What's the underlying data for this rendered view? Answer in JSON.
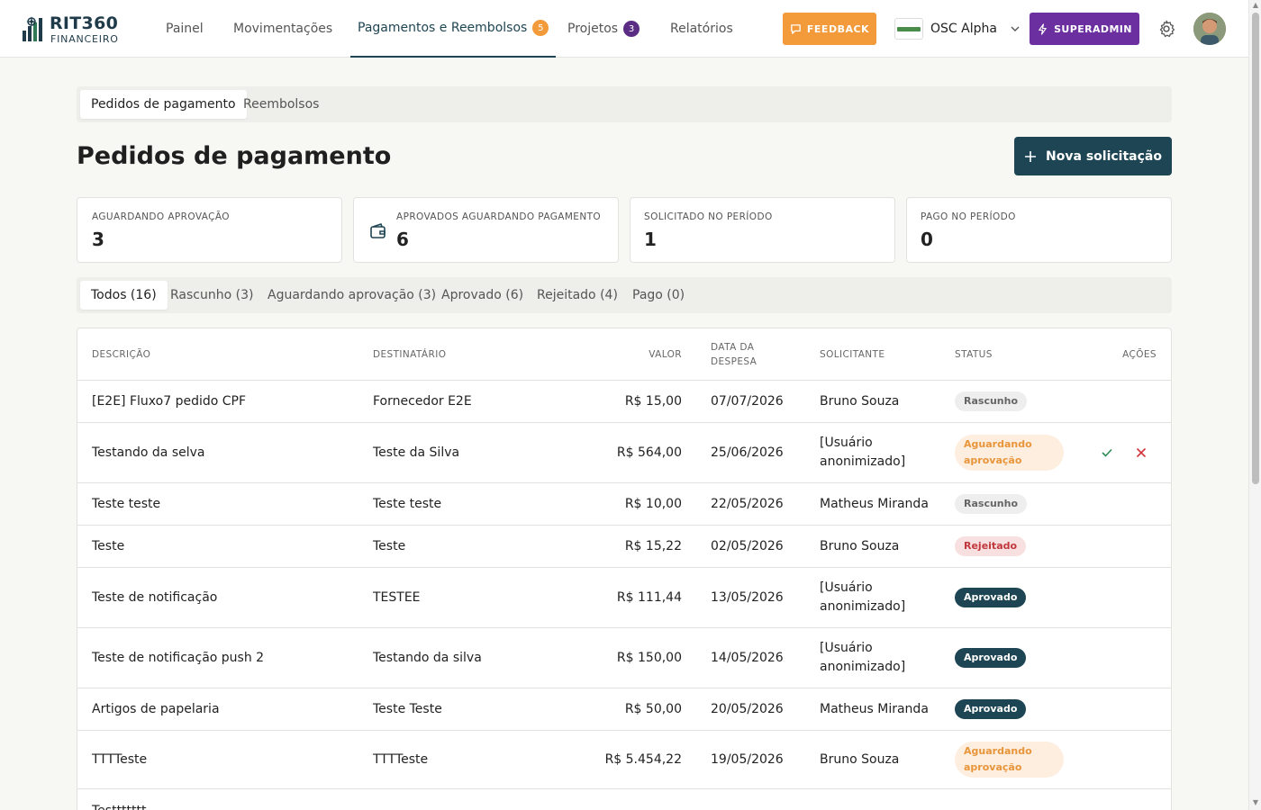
{
  "app": {
    "logo_title": "RIT360",
    "logo_sub": "FINANCEIRO"
  },
  "nav": {
    "items": [
      {
        "label": "Painel"
      },
      {
        "label": "Movimentações"
      },
      {
        "label": "Pagamentos e Reembolsos",
        "badge": "5",
        "badge_color": "#f39a3a"
      },
      {
        "label": "Projetos",
        "badge": "3",
        "badge_color": "#5b2c83"
      },
      {
        "label": "Relatórios"
      }
    ],
    "feedback_label": "FEEDBACK",
    "org_name": "OSC Alpha",
    "superadmin_label": "SUPERADMIN"
  },
  "subtabs": [
    "Pedidos de pagamento",
    "Reembolsos"
  ],
  "page": {
    "title": "Pedidos de pagamento",
    "new_button": "Nova solicitação"
  },
  "stats": [
    {
      "label": "AGUARDANDO APROVAÇÃO",
      "value": "3"
    },
    {
      "label": "APROVADOS AGUARDANDO PAGAMENTO",
      "value": "6"
    },
    {
      "label": "SOLICITADO NO PERÍODO",
      "value": "1"
    },
    {
      "label": "PAGO NO PERÍODO",
      "value": "0"
    }
  ],
  "filters": [
    "Todos (16)",
    "Rascunho (3)",
    "Aguardando aprovação (3)",
    "Aprovado (6)",
    "Rejeitado (4)",
    "Pago (0)"
  ],
  "table": {
    "columns": {
      "descricao": "DESCRIÇÃO",
      "destinatario": "DESTINATÁRIO",
      "valor": "VALOR",
      "data_line1": "DATA DA",
      "data_line2": "DESPESA",
      "solicitante": "SOLICITANTE",
      "status": "STATUS",
      "acoes": "AÇÕES"
    },
    "rows": [
      {
        "descricao": "[E2E] Fluxo7 pedido CPF",
        "destinatario": "Fornecedor E2E",
        "valor": "R$ 15,00",
        "data": "07/07/2026",
        "solicitante_1": "Bruno Souza",
        "solicitante_2": "",
        "status_1": "Rascunho",
        "status_2": ""
      },
      {
        "descricao": "Testando da selva",
        "destinatario": "Teste da Silva",
        "valor": "R$ 564,00",
        "data": "25/06/2026",
        "solicitante_1": "[Usuário",
        "solicitante_2": "anonimizado]",
        "status_1": "Aguardando",
        "status_2": "aprovação"
      },
      {
        "descricao": "Teste teste",
        "destinatario": "Teste teste",
        "valor": "R$ 10,00",
        "data": "22/05/2026",
        "solicitante_1": "Matheus Miranda",
        "solicitante_2": "",
        "status_1": "Rascunho",
        "status_2": ""
      },
      {
        "descricao": "Teste",
        "destinatario": "Teste",
        "valor": "R$ 15,22",
        "data": "02/05/2026",
        "solicitante_1": "Bruno Souza",
        "solicitante_2": "",
        "status_1": "Rejeitado",
        "status_2": ""
      },
      {
        "descricao": "Teste de notificação",
        "destinatario": "TESTEE",
        "valor": "R$ 111,44",
        "data": "13/05/2026",
        "solicitante_1": "[Usuário",
        "solicitante_2": "anonimizado]",
        "status_1": "Aprovado",
        "status_2": ""
      },
      {
        "descricao": "Teste de notificação push 2",
        "destinatario": "Testando da silva",
        "valor": "R$ 150,00",
        "data": "14/05/2026",
        "solicitante_1": "[Usuário",
        "solicitante_2": "anonimizado]",
        "status_1": "Aprovado",
        "status_2": ""
      },
      {
        "descricao": "Artigos de papelaria",
        "destinatario": "Teste Teste",
        "valor": "R$ 50,00",
        "data": "20/05/2026",
        "solicitante_1": "Matheus Miranda",
        "solicitante_2": "",
        "status_1": "Aprovado",
        "status_2": ""
      },
      {
        "descricao": "TTTTeste",
        "destinatario": "TTTTeste",
        "valor": "R$ 5.454,22",
        "data": "19/05/2026",
        "solicitante_1": "Bruno Souza",
        "solicitante_2": "",
        "status_1": "Aguardando",
        "status_2": "aprovação"
      },
      {
        "descricao": "Testtttttt",
        "destinatario": "",
        "valor": "",
        "data": "",
        "solicitante_1": "",
        "solicitante_2": "",
        "status_1": "",
        "status_2": ""
      }
    ]
  },
  "colors": {
    "primary": "#1e4553",
    "feedback": "#f39a3a",
    "superadmin": "#6b2fa0",
    "approve_check": "#2e8b57",
    "reject_x": "#d0343a",
    "status_draft_bg": "#eeeeee",
    "status_pending_bg": "#fdeee0",
    "status_pending_fg": "#e8953a",
    "status_rejected_bg": "#f9e0e0",
    "status_rejected_fg": "#c0383c",
    "status_approved_bg": "#1e4553"
  }
}
